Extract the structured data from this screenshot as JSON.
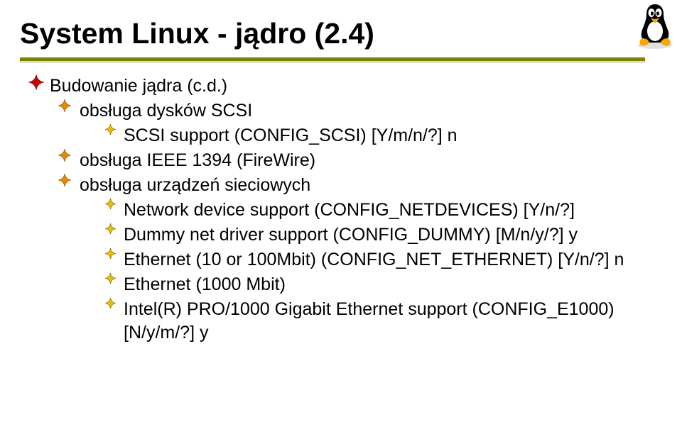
{
  "title": "System Linux  - jądro (2.4)",
  "bullets": [
    {
      "level": 0,
      "text": "Budowanie jądra (c.d.)"
    },
    {
      "level": 1,
      "text": "obsługa dysków SCSI"
    },
    {
      "level": 2,
      "text": "SCSI support (CONFIG_SCSI) [Y/m/n/?] n"
    },
    {
      "level": 1,
      "text": "obsługa IEEE 1394 (FireWire)"
    },
    {
      "level": 1,
      "text": "obsługa urządzeń sieciowych"
    },
    {
      "level": 2,
      "text": "Network device support (CONFIG_NETDEVICES) [Y/n/?]"
    },
    {
      "level": 2,
      "text": "Dummy net driver support (CONFIG_DUMMY) [M/n/y/?] y"
    },
    {
      "level": 2,
      "text": "Ethernet (10 or 100Mbit) (CONFIG_NET_ETHERNET) [Y/n/?] n"
    },
    {
      "level": 2,
      "text": "Ethernet (1000 Mbit)"
    },
    {
      "level": 2,
      "text": "Intel(R) PRO/1000 Gigabit Ethernet support (CONFIG_E1000) [N/y/m/?] y"
    }
  ]
}
